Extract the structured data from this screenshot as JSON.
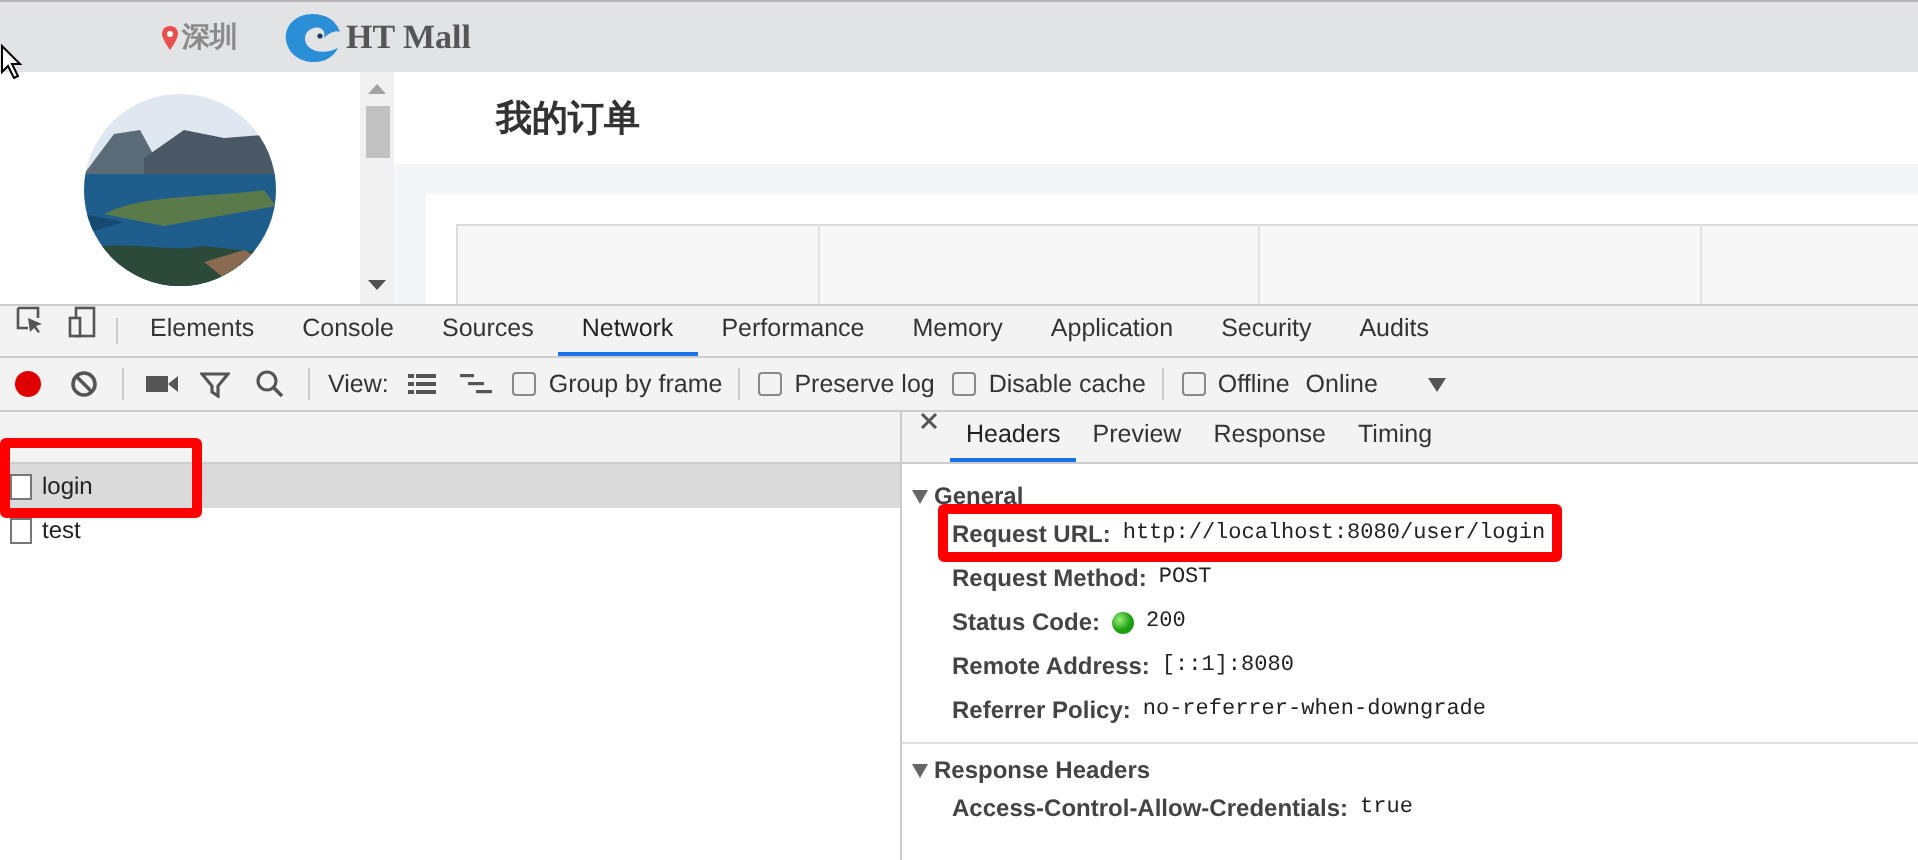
{
  "site_header": {
    "location": "深圳",
    "brand": "HT Mall"
  },
  "page": {
    "title": "我的订单"
  },
  "devtools": {
    "tabs": [
      {
        "label": "Elements",
        "selected": false
      },
      {
        "label": "Console",
        "selected": false
      },
      {
        "label": "Sources",
        "selected": false
      },
      {
        "label": "Network",
        "selected": true
      },
      {
        "label": "Performance",
        "selected": false
      },
      {
        "label": "Memory",
        "selected": false
      },
      {
        "label": "Application",
        "selected": false
      },
      {
        "label": "Security",
        "selected": false
      },
      {
        "label": "Audits",
        "selected": false
      }
    ],
    "toolbar": {
      "view_label": "View:",
      "options": [
        {
          "label": "Group by frame",
          "checked": false
        },
        {
          "label": "Preserve log",
          "checked": false
        },
        {
          "label": "Disable cache",
          "checked": false
        },
        {
          "label": "Offline",
          "checked": false
        }
      ],
      "throttling": "Online"
    },
    "requests": [
      {
        "name": "login",
        "selected": true,
        "highlighted": true
      },
      {
        "name": "test",
        "selected": false,
        "highlighted": false
      }
    ],
    "detail_tabs": [
      {
        "label": "Headers",
        "selected": true
      },
      {
        "label": "Preview",
        "selected": false
      },
      {
        "label": "Response",
        "selected": false
      },
      {
        "label": "Timing",
        "selected": false
      }
    ],
    "sections": [
      {
        "title": "General",
        "expanded": true,
        "rows": [
          {
            "key": "Request URL:",
            "value": "http://localhost:8080/user/login",
            "highlighted": true
          },
          {
            "key": "Request Method:",
            "value": "POST",
            "highlighted": false
          },
          {
            "key": "Status Code:",
            "value": "200",
            "kind": "status",
            "highlighted": false
          },
          {
            "key": "Remote Address:",
            "value": "[::1]:8080",
            "highlighted": false
          },
          {
            "key": "Referrer Policy:",
            "value": "no-referrer-when-downgrade",
            "highlighted": false
          }
        ]
      },
      {
        "title": "Response Headers",
        "expanded": true,
        "rows": [
          {
            "key": "Access-Control-Allow-Credentials:",
            "value": "true",
            "highlighted": false
          }
        ]
      }
    ]
  }
}
